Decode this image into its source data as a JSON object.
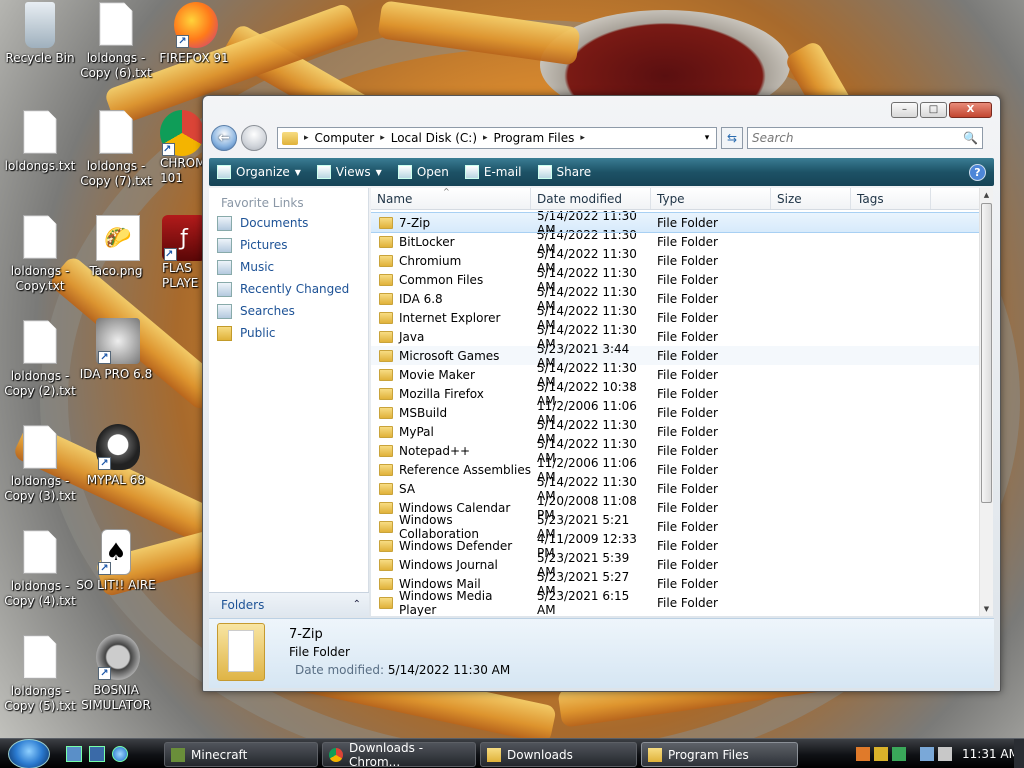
{
  "desktop": {
    "icons": [
      {
        "label": "Recycle Bin",
        "icon": "recycle-bin-icon"
      },
      {
        "label": "loldongs - Copy (6).txt",
        "icon": "text-file-icon"
      },
      {
        "label": "FIREFOX 91",
        "icon": "firefox-icon"
      },
      {
        "label": "loldongs.txt",
        "icon": "text-file-icon"
      },
      {
        "label": "loldongs - Copy (7).txt",
        "icon": "text-file-icon"
      },
      {
        "label": "CHROM 101",
        "icon": "chrome-icon"
      },
      {
        "label": "loldongs - Copy.txt",
        "icon": "text-file-icon"
      },
      {
        "label": "Taco.png",
        "icon": "image-file-icon"
      },
      {
        "label": "FLAS PLAYE",
        "icon": "flash-player-icon"
      },
      {
        "label": "loldongs - Copy (2).txt",
        "icon": "text-file-icon"
      },
      {
        "label": "IDA PRO 6.8",
        "icon": "ida-pro-icon"
      },
      {
        "label": "loldongs - Copy (3).txt",
        "icon": "text-file-icon"
      },
      {
        "label": "MYPAL 68",
        "icon": "mypal-icon"
      },
      {
        "label": "loldongs - Copy (4).txt",
        "icon": "text-file-icon"
      },
      {
        "label": "SO LIT!! AIRE",
        "icon": "solitaire-icon"
      },
      {
        "label": "loldongs - Copy (5).txt",
        "icon": "text-file-icon"
      },
      {
        "label": "BOSNIA SIMULATOR",
        "icon": "bosnia-simulator-icon"
      }
    ]
  },
  "window": {
    "caption": {
      "minimize": "–",
      "maximize": "□",
      "close": "X"
    },
    "address": {
      "crumbs": [
        "Computer",
        "Local Disk (C:)",
        "Program Files"
      ],
      "separator": "▸",
      "dropdown": "▾"
    },
    "search": {
      "placeholder": "Search",
      "icon": "🔍"
    },
    "toolbar": {
      "organize": "Organize",
      "views": "Views",
      "open": "Open",
      "email": "E-mail",
      "share": "Share",
      "help": "?"
    },
    "nav": {
      "favorite_links_title": "Favorite Links",
      "links": [
        "Documents",
        "Pictures",
        "Music",
        "Recently Changed",
        "Searches",
        "Public"
      ],
      "folders_label": "Folders",
      "folders_chevron": "⌃"
    },
    "columns": {
      "name": "Name",
      "date_modified": "Date modified",
      "type": "Type",
      "size": "Size",
      "tags": "Tags",
      "sort_caret": "^"
    },
    "files": [
      {
        "name": "7-Zip",
        "date": "5/14/2022 11:30 AM",
        "type": "File Folder",
        "selected": true
      },
      {
        "name": "BitLocker",
        "date": "5/14/2022 11:30 AM",
        "type": "File Folder"
      },
      {
        "name": "Chromium",
        "date": "5/14/2022 11:30 AM",
        "type": "File Folder"
      },
      {
        "name": "Common Files",
        "date": "5/14/2022 11:30 AM",
        "type": "File Folder"
      },
      {
        "name": "IDA 6.8",
        "date": "5/14/2022 11:30 AM",
        "type": "File Folder"
      },
      {
        "name": "Internet Explorer",
        "date": "5/14/2022 11:30 AM",
        "type": "File Folder"
      },
      {
        "name": "Java",
        "date": "5/14/2022 11:30 AM",
        "type": "File Folder"
      },
      {
        "name": "Microsoft Games",
        "date": "5/23/2021 3:44 AM",
        "type": "File Folder",
        "hover": true
      },
      {
        "name": "Movie Maker",
        "date": "5/14/2022 11:30 AM",
        "type": "File Folder"
      },
      {
        "name": "Mozilla Firefox",
        "date": "5/14/2022 10:38 AM",
        "type": "File Folder"
      },
      {
        "name": "MSBuild",
        "date": "11/2/2006 11:06 AM",
        "type": "File Folder"
      },
      {
        "name": "MyPal",
        "date": "5/14/2022 11:30 AM",
        "type": "File Folder"
      },
      {
        "name": "Notepad++",
        "date": "5/14/2022 11:30 AM",
        "type": "File Folder"
      },
      {
        "name": "Reference Assemblies",
        "date": "11/2/2006 11:06 AM",
        "type": "File Folder"
      },
      {
        "name": "SA",
        "date": "5/14/2022 11:30 AM",
        "type": "File Folder"
      },
      {
        "name": "Windows Calendar",
        "date": "1/20/2008 11:08 PM",
        "type": "File Folder"
      },
      {
        "name": "Windows Collaboration",
        "date": "5/23/2021 5:21 AM",
        "type": "File Folder"
      },
      {
        "name": "Windows Defender",
        "date": "4/11/2009 12:33 PM",
        "type": "File Folder"
      },
      {
        "name": "Windows Journal",
        "date": "5/23/2021 5:39 AM",
        "type": "File Folder"
      },
      {
        "name": "Windows Mail",
        "date": "5/23/2021 5:27 AM",
        "type": "File Folder"
      },
      {
        "name": "Windows Media Player",
        "date": "5/23/2021 6:15 AM",
        "type": "File Folder"
      }
    ],
    "details": {
      "name": "7-Zip",
      "type": "File Folder",
      "date_label": "Date modified:",
      "date_value": "5/14/2022 11:30 AM"
    }
  },
  "taskbar": {
    "tasks": [
      {
        "label": "Minecraft"
      },
      {
        "label": "Downloads - Chrom..."
      },
      {
        "label": "Downloads"
      },
      {
        "label": "Program Files",
        "active": true
      }
    ],
    "clock": "11:31 AM"
  }
}
